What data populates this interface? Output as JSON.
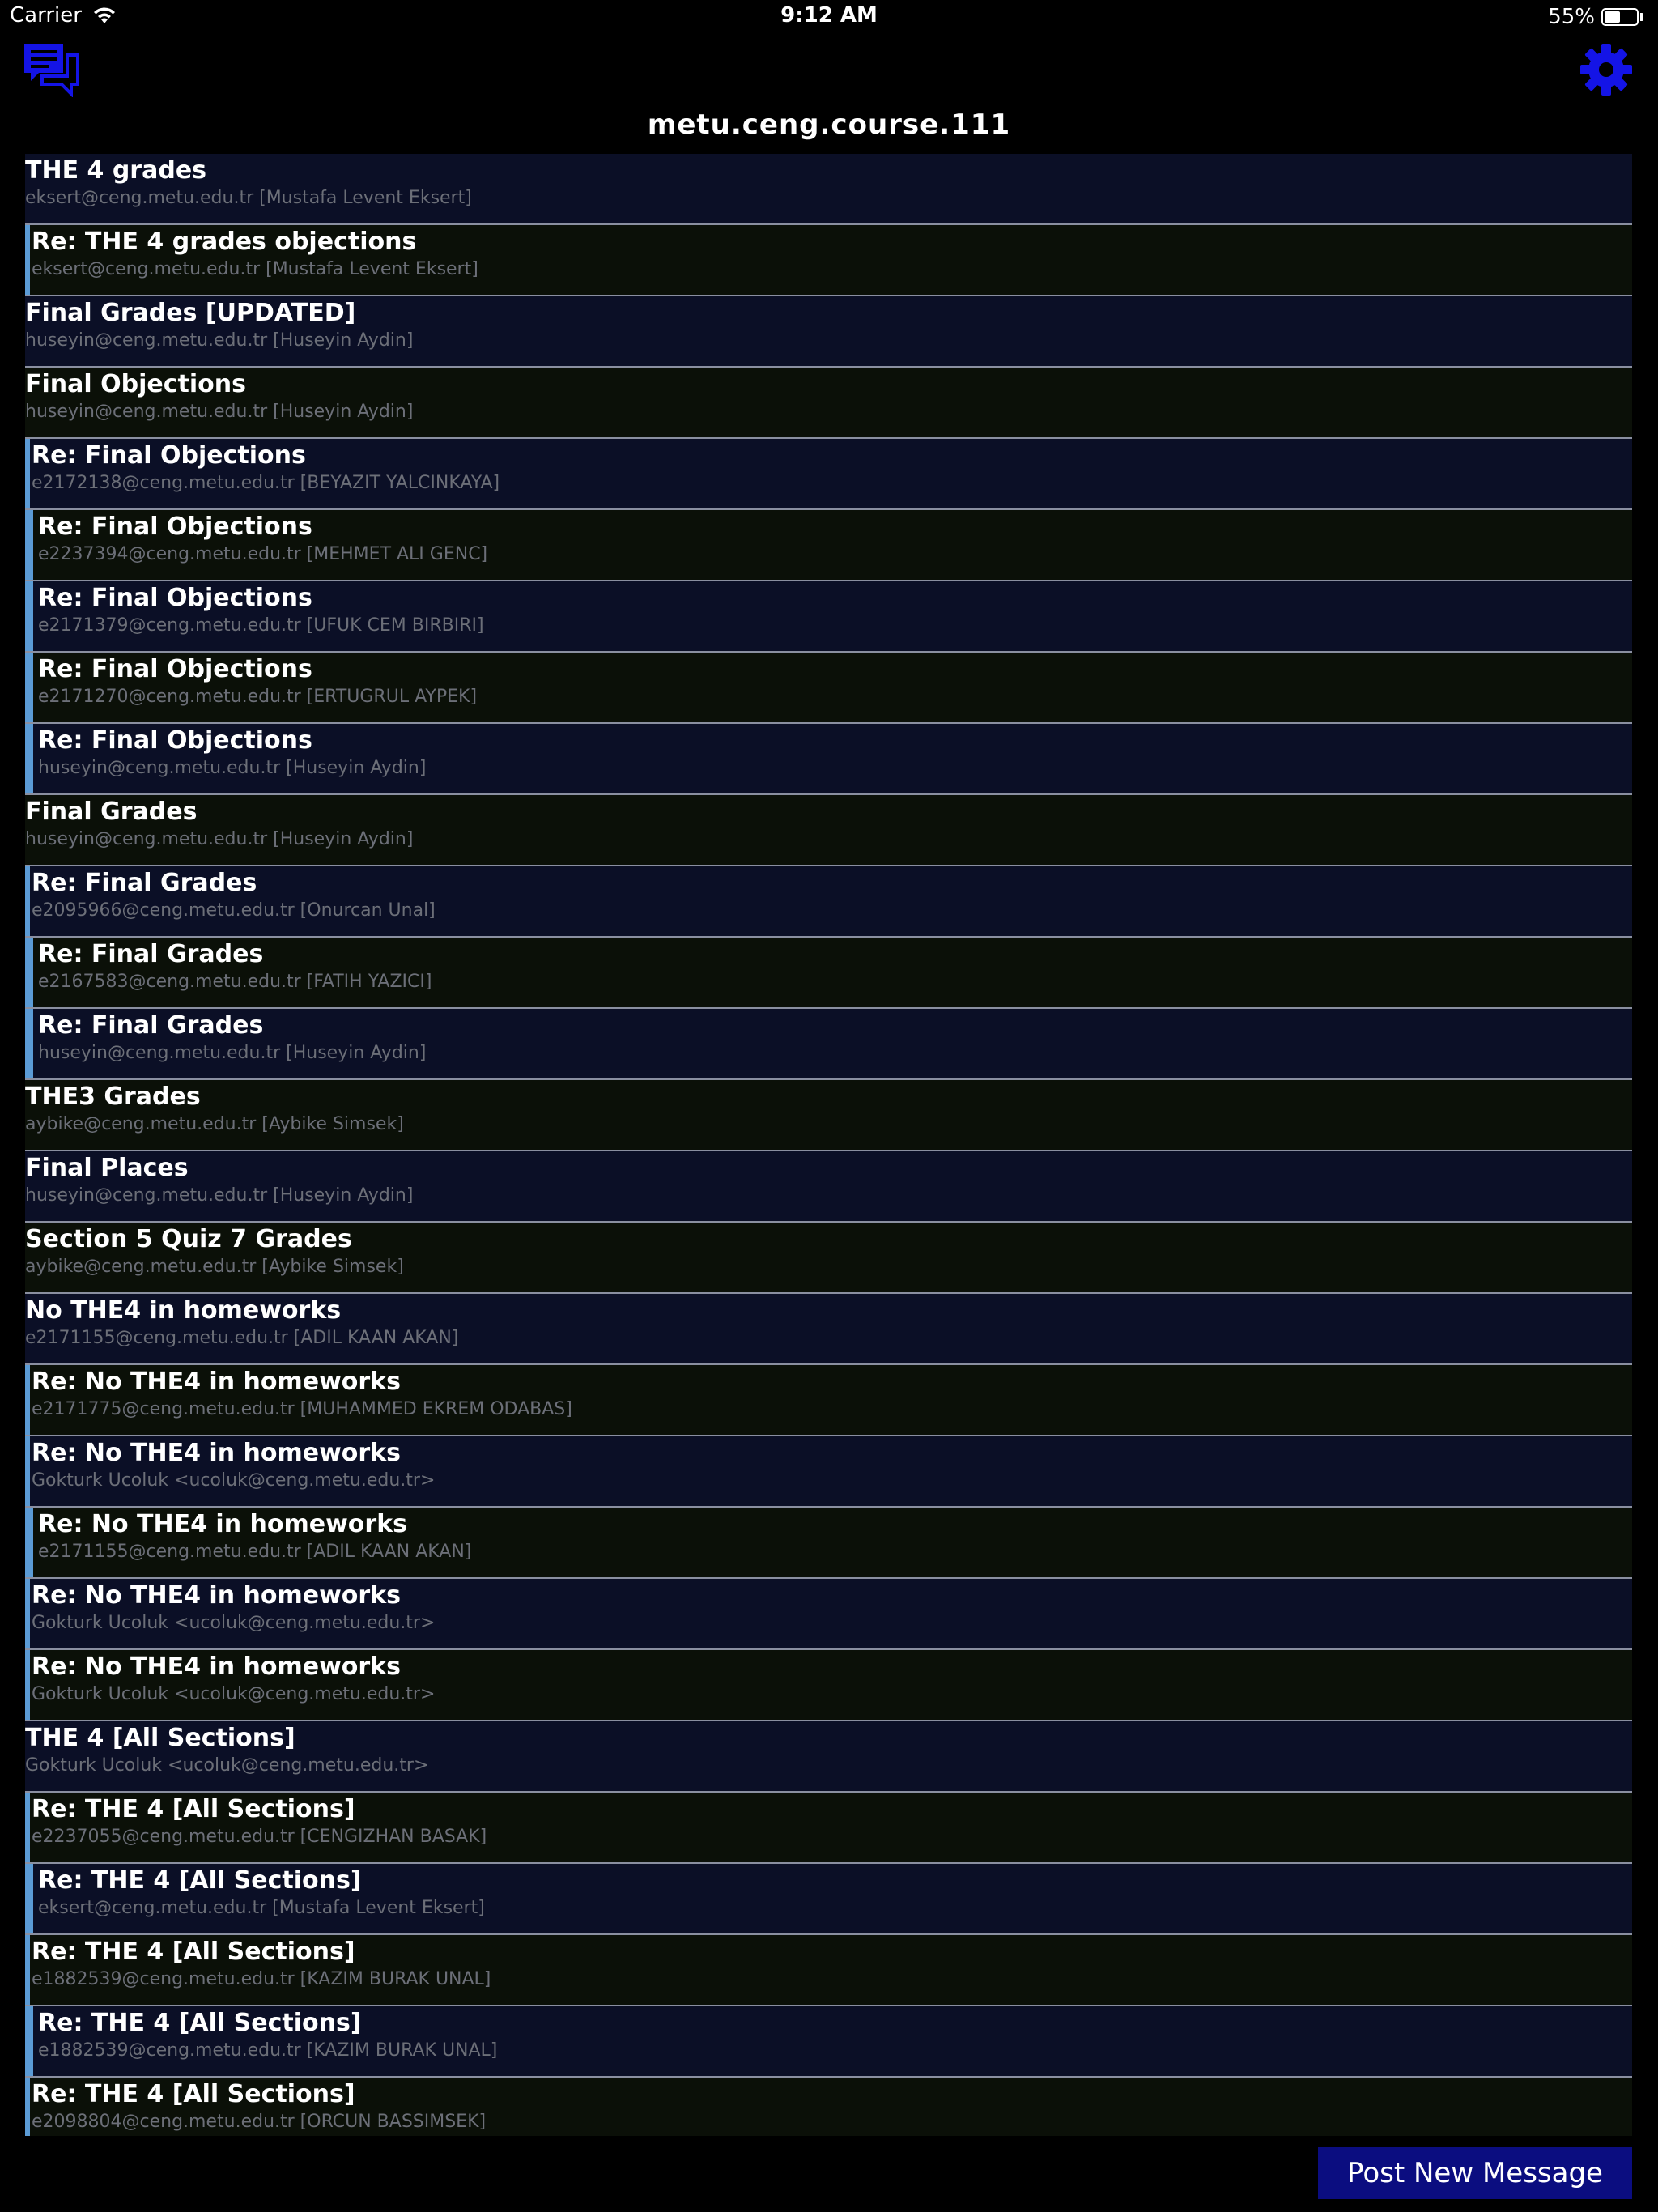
{
  "status_bar": {
    "carrier": "Carrier",
    "time": "9:12 AM",
    "battery_label": "55%",
    "battery_level": 0.55
  },
  "header": {
    "title": "metu.ceng.course.111",
    "left_icon": "chat-bubbles-icon",
    "right_icon": "gear-icon",
    "accent_color": "#1414e6"
  },
  "colors": {
    "row_a": "#0b0f26",
    "row_b": "#0b1008",
    "thread_bar": "#5b9bd5",
    "button_bg": "#0b0d80"
  },
  "messages": [
    {
      "subject": "THE 4 grades",
      "sender": "eksert@ceng.metu.edu.tr [Mustafa Levent Eksert]",
      "depth": 0
    },
    {
      "subject": "Re: THE 4 grades objections",
      "sender": "eksert@ceng.metu.edu.tr [Mustafa Levent Eksert]",
      "depth": 1
    },
    {
      "subject": "Final Grades [UPDATED]",
      "sender": "huseyin@ceng.metu.edu.tr [Huseyin Aydin]",
      "depth": 0
    },
    {
      "subject": "Final Objections",
      "sender": "huseyin@ceng.metu.edu.tr [Huseyin Aydin]",
      "depth": 0
    },
    {
      "subject": "Re: Final Objections",
      "sender": "e2172138@ceng.metu.edu.tr [BEYAZIT YALCINKAYA]",
      "depth": 1
    },
    {
      "subject": "Re: Final Objections",
      "sender": "e2237394@ceng.metu.edu.tr [MEHMET ALI GENC]",
      "depth": 2
    },
    {
      "subject": "Re: Final Objections",
      "sender": "e2171379@ceng.metu.edu.tr [UFUK CEM BIRBIRI]",
      "depth": 2
    },
    {
      "subject": "Re: Final Objections",
      "sender": "e2171270@ceng.metu.edu.tr [ERTUGRUL AYPEK]",
      "depth": 2
    },
    {
      "subject": "Re: Final Objections",
      "sender": "huseyin@ceng.metu.edu.tr [Huseyin Aydin]",
      "depth": 2
    },
    {
      "subject": "Final Grades",
      "sender": "huseyin@ceng.metu.edu.tr [Huseyin Aydin]",
      "depth": 0
    },
    {
      "subject": "Re: Final Grades",
      "sender": "e2095966@ceng.metu.edu.tr [Onurcan Unal]",
      "depth": 1
    },
    {
      "subject": "Re: Final Grades",
      "sender": "e2167583@ceng.metu.edu.tr [FATIH YAZICI]",
      "depth": 2
    },
    {
      "subject": "Re: Final Grades",
      "sender": "huseyin@ceng.metu.edu.tr [Huseyin Aydin]",
      "depth": 2
    },
    {
      "subject": "THE3 Grades",
      "sender": "aybike@ceng.metu.edu.tr [Aybike Simsek]",
      "depth": 0
    },
    {
      "subject": "Final Places",
      "sender": "huseyin@ceng.metu.edu.tr [Huseyin Aydin]",
      "depth": 0
    },
    {
      "subject": "Section 5 Quiz 7 Grades",
      "sender": "aybike@ceng.metu.edu.tr [Aybike Simsek]",
      "depth": 0
    },
    {
      "subject": "No THE4 in homeworks",
      "sender": "e2171155@ceng.metu.edu.tr [ADIL KAAN AKAN]",
      "depth": 0
    },
    {
      "subject": "Re: No THE4 in homeworks",
      "sender": "e2171775@ceng.metu.edu.tr [MUHAMMED EKREM ODABAS]",
      "depth": 1
    },
    {
      "subject": "Re: No THE4 in homeworks",
      "sender": "Gokturk Ucoluk <ucoluk@ceng.metu.edu.tr>",
      "depth": 1
    },
    {
      "subject": "Re: No THE4 in homeworks",
      "sender": "e2171155@ceng.metu.edu.tr [ADIL KAAN AKAN]",
      "depth": 2
    },
    {
      "subject": "Re: No THE4 in homeworks",
      "sender": "Gokturk Ucoluk <ucoluk@ceng.metu.edu.tr>",
      "depth": 1
    },
    {
      "subject": "Re: No THE4 in homeworks",
      "sender": "Gokturk Ucoluk <ucoluk@ceng.metu.edu.tr>",
      "depth": 1
    },
    {
      "subject": "THE 4 [All Sections]",
      "sender": "Gokturk Ucoluk <ucoluk@ceng.metu.edu.tr>",
      "depth": 0
    },
    {
      "subject": "Re: THE 4 [All Sections]",
      "sender": "e2237055@ceng.metu.edu.tr [CENGIZHAN BASAK]",
      "depth": 1
    },
    {
      "subject": "Re: THE 4 [All Sections]",
      "sender": "eksert@ceng.metu.edu.tr [Mustafa Levent Eksert]",
      "depth": 2
    },
    {
      "subject": "Re: THE 4 [All Sections]",
      "sender": "e1882539@ceng.metu.edu.tr [KAZIM BURAK UNAL]",
      "depth": 1
    },
    {
      "subject": "Re: THE 4 [All Sections]",
      "sender": "e1882539@ceng.metu.edu.tr [KAZIM BURAK UNAL]",
      "depth": 2
    },
    {
      "subject": "Re: THE 4 [All Sections]",
      "sender": "e2098804@ceng.metu.edu.tr [ORCUN BASSIMSEK]",
      "depth": 1
    }
  ],
  "footer": {
    "post_button_label": "Post New Message"
  }
}
